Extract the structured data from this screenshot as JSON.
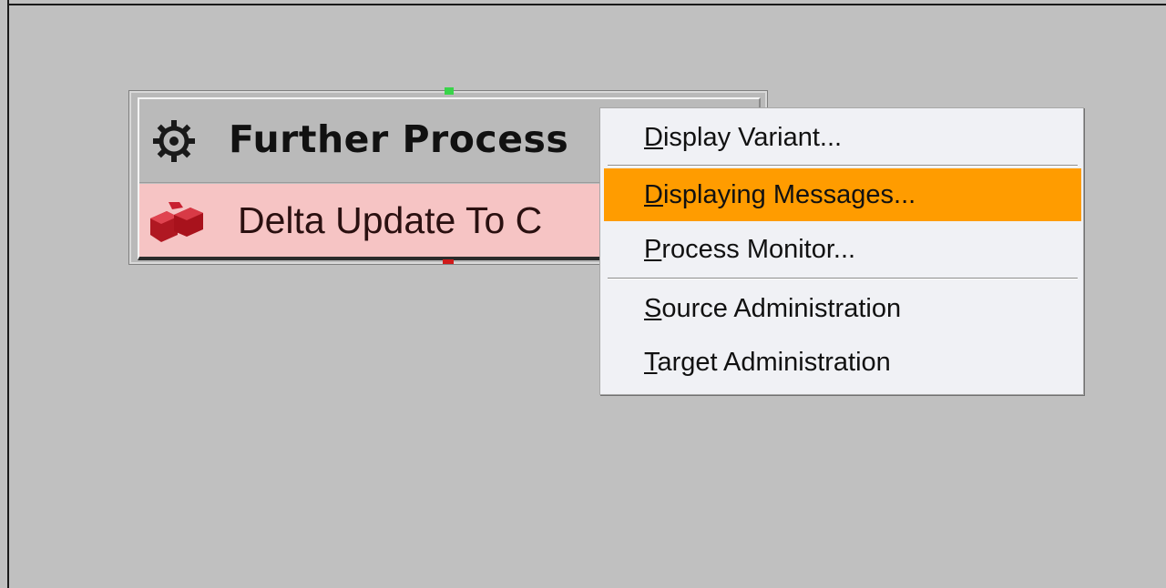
{
  "node": {
    "title": "Further Process",
    "subtitle": "Delta Update To C",
    "icons": {
      "header": "gear-icon",
      "row": "data-transfer-process-icon"
    },
    "colors": {
      "row_background": "#f6c4c4",
      "connector_in": "#39d44a",
      "connector_out": "#d01a1a"
    }
  },
  "context_menu": {
    "highlight_color": "#ff9c00",
    "items": [
      {
        "mnemonic": "D",
        "rest": "isplay Variant...",
        "highlighted": false
      },
      {
        "mnemonic": "D",
        "rest": "isplaying Messages...",
        "highlighted": true
      },
      {
        "mnemonic": "P",
        "rest": "rocess Monitor...",
        "highlighted": false
      },
      {
        "mnemonic": "S",
        "rest": "ource Administration",
        "highlighted": false
      },
      {
        "mnemonic": "T",
        "rest": "arget Administration",
        "highlighted": false
      }
    ]
  }
}
